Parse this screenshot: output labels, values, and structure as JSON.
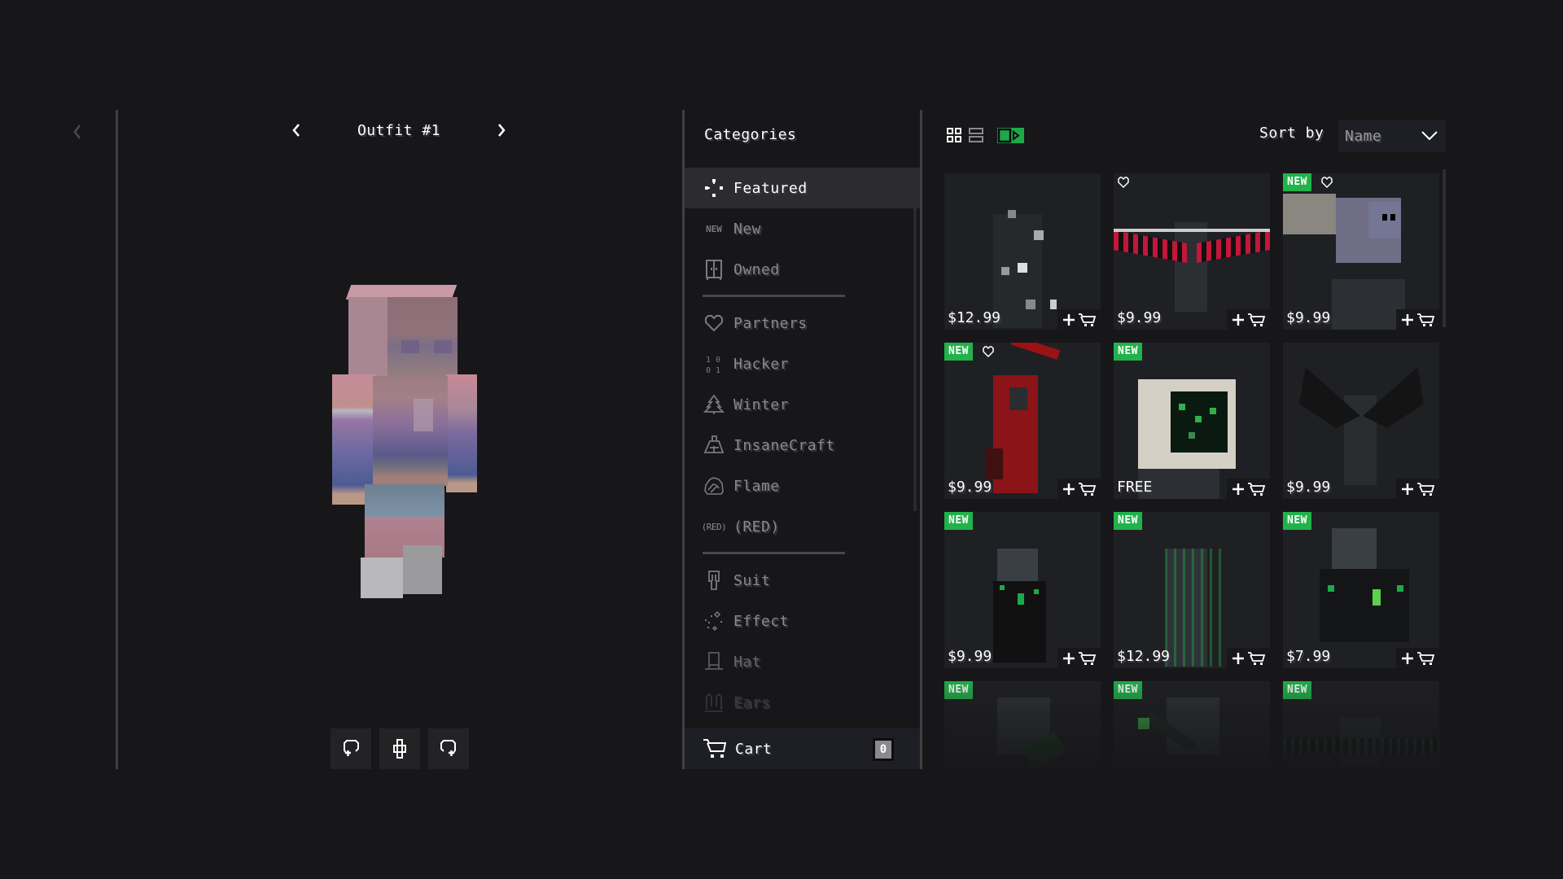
{
  "preview": {
    "back_icon": "chevron-left-icon",
    "outfit_title": "Outfit #1",
    "prev_icon": "chevron-left-icon",
    "next_icon": "chevron-right-icon",
    "controls": [
      {
        "name": "rotate-left-button",
        "icon": "rotate-left-icon"
      },
      {
        "name": "pose-button",
        "icon": "character-icon"
      },
      {
        "name": "rotate-right-button",
        "icon": "rotate-right-icon"
      }
    ]
  },
  "categories": {
    "title": "Categories",
    "groups": [
      [
        {
          "label": "Featured",
          "icon": "featured-icon",
          "active": true
        },
        {
          "label": "New",
          "icon": "new-icon",
          "icon_text": "NEW"
        },
        {
          "label": "Owned",
          "icon": "wardrobe-icon"
        }
      ],
      [
        {
          "label": "Partners",
          "icon": "heart-icon"
        },
        {
          "label": "Hacker",
          "icon": "binary-icon"
        },
        {
          "label": "Winter",
          "icon": "tree-icon"
        },
        {
          "label": "InsaneCraft",
          "icon": "insanecraft-icon"
        },
        {
          "label": "Flame",
          "icon": "flame-icon"
        },
        {
          "label": "(RED)",
          "icon": "red-icon",
          "icon_text": "(RED)"
        }
      ],
      [
        {
          "label": "Suit",
          "icon": "suit-icon"
        },
        {
          "label": "Effect",
          "icon": "sparkle-icon"
        },
        {
          "label": "Hat",
          "icon": "hat-icon"
        },
        {
          "label": "Ears",
          "icon": "ears-icon"
        }
      ]
    ],
    "cart_label": "Cart",
    "cart_count": "0"
  },
  "toolbar": {
    "sort_label": "Sort by",
    "sort_value": "Name",
    "views": [
      "grid-view",
      "list-view",
      "preview-view"
    ],
    "active_view": "preview-view"
  },
  "colors": {
    "background": "#17171a",
    "card": "#1f2024",
    "accent_green": "#22b24c",
    "active_row": "#2c2c30"
  },
  "items": [
    {
      "price": "$12.99",
      "new": false,
      "favorite": false,
      "art": "particles"
    },
    {
      "price": "$9.99",
      "new": false,
      "favorite": true,
      "art": "red-wings"
    },
    {
      "price": "$9.99",
      "new": true,
      "favorite": true,
      "art": "gargoyle"
    },
    {
      "price": "$9.99",
      "new": true,
      "favorite": true,
      "art": "red-reaper"
    },
    {
      "price": "FREE",
      "new": true,
      "favorite": false,
      "art": "computer-head"
    },
    {
      "price": "$9.99",
      "new": false,
      "favorite": false,
      "art": "bat-wings"
    },
    {
      "price": "$9.99",
      "new": true,
      "favorite": false,
      "art": "green-armor"
    },
    {
      "price": "$12.99",
      "new": true,
      "favorite": false,
      "art": "matrix-rain"
    },
    {
      "price": "$7.99",
      "new": true,
      "favorite": false,
      "art": "green-backpack"
    },
    {
      "price": "",
      "new": true,
      "favorite": false,
      "art": "green-shoulder"
    },
    {
      "price": "",
      "new": true,
      "favorite": false,
      "art": "green-sword"
    },
    {
      "price": "",
      "new": true,
      "favorite": false,
      "art": "green-wings"
    }
  ],
  "labels": {
    "new_badge": "NEW"
  }
}
